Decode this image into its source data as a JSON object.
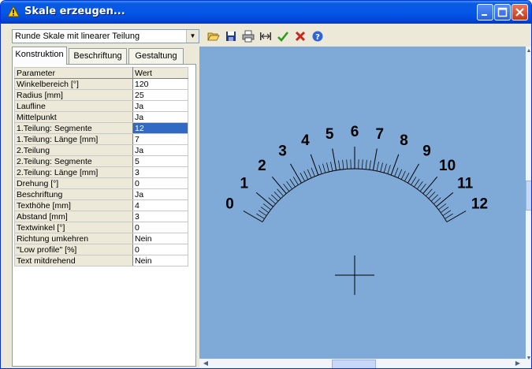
{
  "window": {
    "title": "Skale erzeugen...",
    "controls": [
      "minimize-icon",
      "maximize-icon",
      "close-icon"
    ]
  },
  "toolbar": {
    "combo_value": "Runde Skale mit linearer Teilung",
    "icons": [
      "open-folder-icon",
      "save-icon",
      "print-icon",
      "dimension-icon",
      "check-icon",
      "cancel-icon",
      "help-icon"
    ]
  },
  "tabs": [
    {
      "label": "Konstruktion",
      "active": true
    },
    {
      "label": "Beschriftung",
      "active": false
    },
    {
      "label": "Gestaltung",
      "active": false
    }
  ],
  "grid": {
    "headers": [
      "Parameter",
      "Wert"
    ],
    "rows": [
      {
        "param": "Winkelbereich [°]",
        "value": "120"
      },
      {
        "param": "Radius [mm]",
        "value": "25"
      },
      {
        "param": "Laufline",
        "value": "Ja"
      },
      {
        "param": "Mittelpunkt",
        "value": "Ja"
      },
      {
        "param": "1.Teilung: Segmente",
        "value": "12",
        "selected": true
      },
      {
        "param": "1.Teilung: Länge [mm]",
        "value": "7"
      },
      {
        "param": "2.Teilung",
        "value": "Ja"
      },
      {
        "param": "2.Teilung: Segmente",
        "value": "5"
      },
      {
        "param": "2.Teilung: Länge [mm]",
        "value": "3"
      },
      {
        "param": "Drehung [°]",
        "value": "0"
      },
      {
        "param": "Beschriftung",
        "value": "Ja"
      },
      {
        "param": "Texthöhe [mm]",
        "value": "4"
      },
      {
        "param": "Abstand [mm]",
        "value": "3"
      },
      {
        "param": "Textwinkel [°]",
        "value": "0"
      },
      {
        "param": "Richtung umkehren",
        "value": "Nein"
      },
      {
        "param": "\"Low profile\" [%]",
        "value": "0"
      },
      {
        "param": "Text mitdrehend",
        "value": "Nein"
      }
    ]
  },
  "scale": {
    "labels": [
      "0",
      "1",
      "2",
      "3",
      "4",
      "5",
      "6",
      "7",
      "8",
      "9",
      "10",
      "11",
      "12"
    ],
    "angle_range_deg": 120,
    "major_segments": 12,
    "minor_segments": 5
  },
  "colors": {
    "canvas_bg": "#7fa9d6",
    "selection": "#316ac5",
    "title_blue": "#0458e8"
  }
}
